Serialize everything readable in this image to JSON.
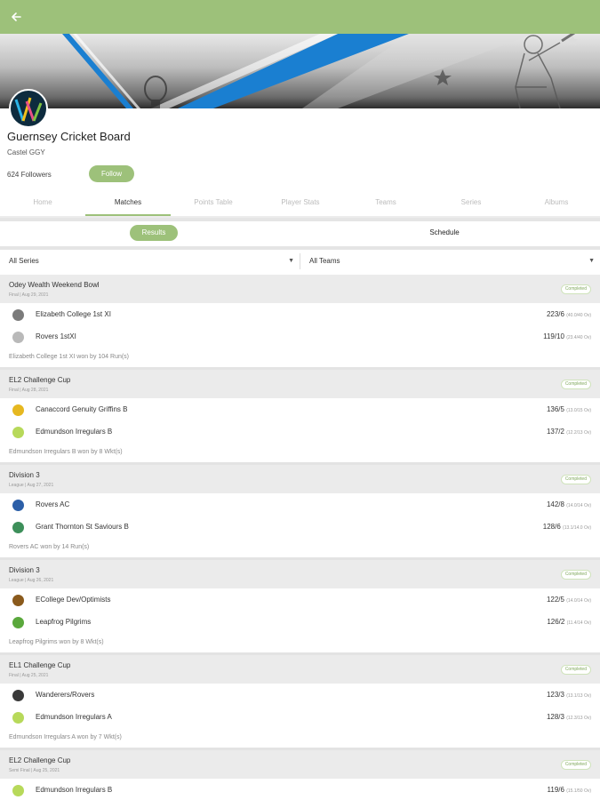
{
  "club": {
    "name": "Guernsey Cricket Board",
    "location": "Castel GGY",
    "followers": "624 Followers",
    "follow_label": "Follow"
  },
  "tabs": [
    "Home",
    "Matches",
    "Points Table",
    "Player Stats",
    "Teams",
    "Series",
    "Albums"
  ],
  "active_tab": "Matches",
  "segments": {
    "results": "Results",
    "schedule": "Schedule"
  },
  "filters": {
    "series": "All Series",
    "teams": "All Teams"
  },
  "colors": {
    "accent": "#9dc17a",
    "banner_stripe": "#1a7fd1"
  },
  "icons": {
    "back": "arrow-left-icon",
    "dropdown": "caret-down-icon"
  },
  "matches": [
    {
      "series": "Odey Wealth Weekend Bowl",
      "round": "Final | Aug 29, 2021",
      "status": "Completed",
      "teams": [
        {
          "name": "Elizabeth College 1st XI",
          "score": "223/6",
          "overs": "(40.0/40 Ov)",
          "logo": "#7b7b7b"
        },
        {
          "name": "Rovers 1stXI",
          "score": "119/10",
          "overs": "(23.4/40 Ov)",
          "logo": "#b9b9b9"
        }
      ],
      "result": "Elizabeth College 1st XI won by 104 Run(s)"
    },
    {
      "series": "EL2 Challenge Cup",
      "round": "Final | Aug 28, 2021",
      "status": "Completed",
      "teams": [
        {
          "name": "Canaccord Genuity Griffins B",
          "score": "136/5",
          "overs": "(13.0/15 Ov)",
          "logo": "#e6b820"
        },
        {
          "name": "Edmundson Irregulars B",
          "score": "137/2",
          "overs": "(12.2/13 Ov)",
          "logo": "#b7d95a"
        }
      ],
      "result": "Edmundson Irregulars B won by 8 Wkt(s)"
    },
    {
      "series": "Division 3",
      "round": "League | Aug 27, 2021",
      "status": "Completed",
      "teams": [
        {
          "name": "Rovers AC",
          "score": "142/8",
          "overs": "(14.0/14 Ov)",
          "logo": "#2c5fa8"
        },
        {
          "name": "Grant Thornton St Saviours B",
          "score": "128/6",
          "overs": "(13.1/14.0 Ov)",
          "logo": "#3d8f5a"
        }
      ],
      "result": "Rovers AC won by 14 Run(s)"
    },
    {
      "series": "Division 3",
      "round": "League | Aug 26, 2021",
      "status": "Completed",
      "teams": [
        {
          "name": "ECollege Dev/Optimists",
          "score": "122/5",
          "overs": "(14.0/14 Ov)",
          "logo": "#8a5a1c"
        },
        {
          "name": "Leapfrog Pilgrims",
          "score": "126/2",
          "overs": "(11.4/14 Ov)",
          "logo": "#5aa83c"
        }
      ],
      "result": "Leapfrog Pilgrims won by 8 Wkt(s)"
    },
    {
      "series": "EL1 Challenge Cup",
      "round": "Final | Aug 25, 2021",
      "status": "Completed",
      "teams": [
        {
          "name": "Wanderers/Rovers",
          "score": "123/3",
          "overs": "(13.1/13 Ov)",
          "logo": "#3a3a3a"
        },
        {
          "name": "Edmundson Irregulars A",
          "score": "128/3",
          "overs": "(12.3/13 Ov)",
          "logo": "#b7d95a"
        }
      ],
      "result": "Edmundson Irregulars A won by 7 Wkt(s)"
    },
    {
      "series": "EL2 Challenge Cup",
      "round": "Semi Final | Aug 25, 2021",
      "status": "Completed",
      "teams": [
        {
          "name": "Edmundson Irregulars B",
          "score": "119/6",
          "overs": "(15.1/50 Ov)",
          "logo": "#b7d95a"
        }
      ],
      "result": ""
    }
  ]
}
